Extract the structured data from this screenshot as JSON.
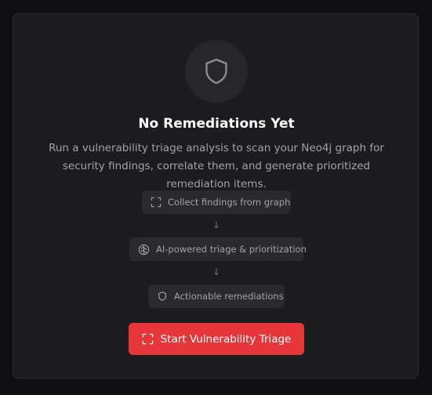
{
  "empty_state": {
    "icon": "shield-icon",
    "title": "No Remediations Yet",
    "description": "Run a vulnerability triage analysis to scan your Neo4j graph for security findings, correlate them, and generate prioritized remediation items."
  },
  "steps": [
    {
      "icon": "scan-icon",
      "label": "Collect findings from graph"
    },
    {
      "icon": "brain-icon",
      "label": "AI-powered triage & prioritization"
    },
    {
      "icon": "shield-icon",
      "label": "Actionable remediations"
    }
  ],
  "arrows": [
    "↓",
    "↓"
  ],
  "action": {
    "icon": "scan-icon",
    "label": "Start Vulnerability Triage"
  },
  "colors": {
    "background": "#101012",
    "card": "#1c1c1f",
    "accent": "#e5373a",
    "muted_text": "#a2a2aa"
  }
}
